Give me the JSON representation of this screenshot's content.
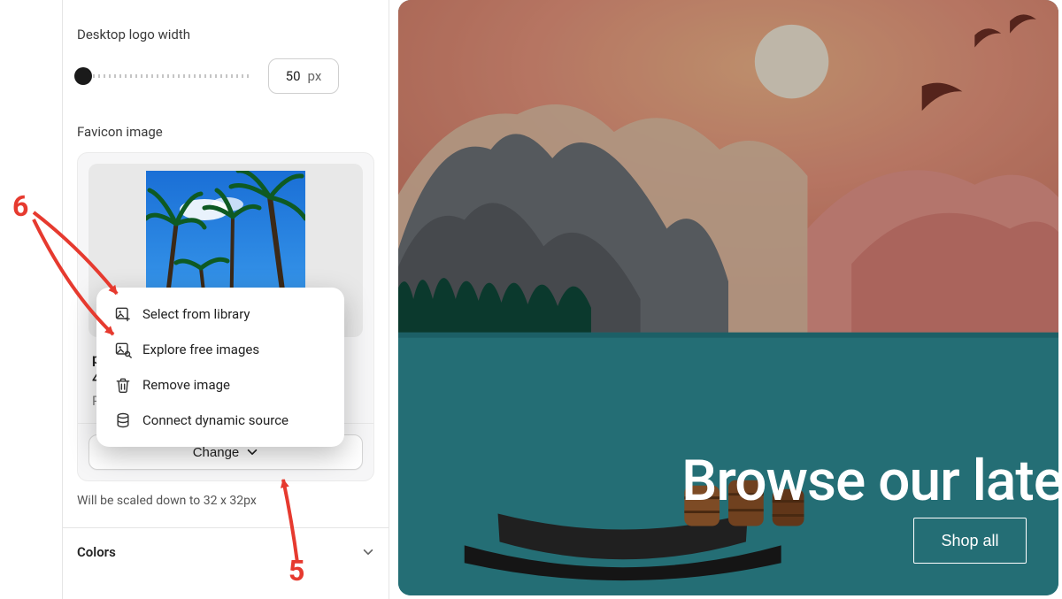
{
  "sidebar": {
    "logo_width": {
      "label": "Desktop logo width",
      "value": "50",
      "unit": "px"
    },
    "favicon": {
      "label": "Favicon image",
      "filename_line1": "pa",
      "filename_line2": "4e",
      "filetype": "PN",
      "change_button": "Change",
      "helper_text": "Will be scaled down to 32 x 32px"
    },
    "popover": {
      "items": [
        {
          "label": "Select from library",
          "icon": "image-plus-icon"
        },
        {
          "label": "Explore free images",
          "icon": "image-search-icon"
        },
        {
          "label": "Remove image",
          "icon": "trash-icon"
        },
        {
          "label": "Connect dynamic source",
          "icon": "database-icon"
        }
      ]
    },
    "colors_section_label": "Colors"
  },
  "preview": {
    "hero_text": "Browse our late",
    "shop_button": "Shop all"
  },
  "annotations": {
    "num_5": "5",
    "num_6": "6"
  }
}
